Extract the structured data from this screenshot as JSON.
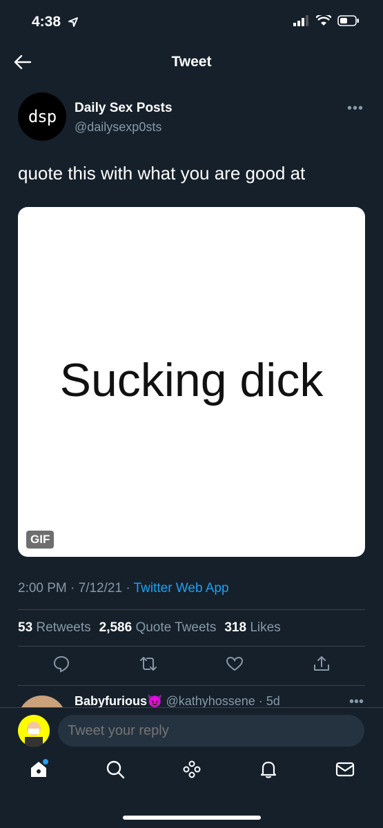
{
  "status": {
    "time": "4:38"
  },
  "header": {
    "title": "Tweet"
  },
  "tweet": {
    "avatar_text": "dsp",
    "name": "Daily Sex Posts",
    "handle": "@dailysexp0sts",
    "text": "quote this with what you are good at",
    "media_text": "Sucking dick",
    "media_badge": "GIF",
    "time": "2:00 PM · 7/12/21 · ",
    "source": "Twitter Web App",
    "stats": {
      "retweets_count": "53",
      "retweets_label": "Retweets",
      "quotes_count": "2,586",
      "quotes_label": "Quote Tweets",
      "likes_count": "318",
      "likes_label": "Likes"
    }
  },
  "reply_preview": {
    "name": "Babyfurious",
    "emoji": "😈",
    "handle": "@kathyhossene · 5d"
  },
  "composer": {
    "placeholder": "Tweet your reply"
  },
  "colors": {
    "background": "#15202b",
    "accent": "#1da1f2",
    "secondary": "#8899a6"
  },
  "icons": [
    "back-arrow-icon",
    "more-icon",
    "reply-icon",
    "retweet-icon",
    "like-icon",
    "share-icon",
    "home-icon",
    "search-icon",
    "spaces-icon",
    "bell-icon",
    "mail-icon"
  ]
}
